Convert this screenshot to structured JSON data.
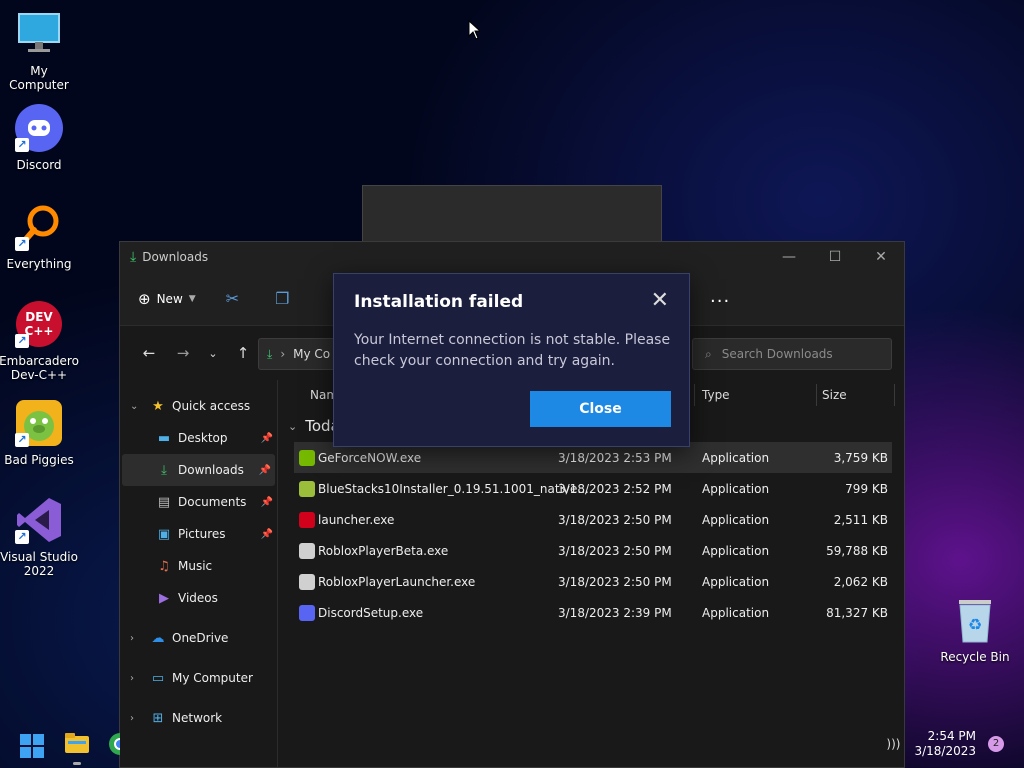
{
  "desktop": {
    "icons": [
      {
        "label": "My Computer"
      },
      {
        "label": "Discord"
      },
      {
        "label": "Everything"
      },
      {
        "label": "Embarcadero Dev-C++"
      },
      {
        "label": "Bad Piggies"
      },
      {
        "label": "Visual Studio 2022"
      },
      {
        "label": "Recycle Bin"
      }
    ]
  },
  "explorer": {
    "title": "Downloads",
    "toolbar": {
      "new_label": "New"
    },
    "address": {
      "path": "My Co"
    },
    "search": {
      "placeholder": "Search Downloads"
    },
    "nav": {
      "quick_access": "Quick access",
      "items": [
        {
          "label": "Desktop"
        },
        {
          "label": "Downloads"
        },
        {
          "label": "Documents"
        },
        {
          "label": "Pictures"
        },
        {
          "label": "Music"
        },
        {
          "label": "Videos"
        }
      ],
      "onedrive": "OneDrive",
      "my_computer": "My Computer",
      "network": "Network"
    },
    "columns": {
      "name": "Nam",
      "type": "Type",
      "size": "Size"
    },
    "group": "Toda",
    "files": [
      {
        "name": "GeForceNOW.exe",
        "date": "3/18/2023 2:53 PM",
        "type": "Application",
        "size": "3,759 KB",
        "icon_color": "#76b900"
      },
      {
        "name": "BlueStacks10Installer_0.19.51.1001_native...",
        "date": "3/18/2023 2:52 PM",
        "type": "Application",
        "size": "799 KB",
        "icon_color": "#9bbf3a"
      },
      {
        "name": "launcher.exe",
        "date": "3/18/2023 2:50 PM",
        "type": "Application",
        "size": "2,511 KB",
        "icon_color": "#d0021b"
      },
      {
        "name": "RobloxPlayerBeta.exe",
        "date": "3/18/2023 2:50 PM",
        "type": "Application",
        "size": "59,788 KB",
        "icon_color": "#d0d0d0"
      },
      {
        "name": "RobloxPlayerLauncher.exe",
        "date": "3/18/2023 2:50 PM",
        "type": "Application",
        "size": "2,062 KB",
        "icon_color": "#d0d0d0"
      },
      {
        "name": "DiscordSetup.exe",
        "date": "3/18/2023 2:39 PM",
        "type": "Application",
        "size": "81,327 KB",
        "icon_color": "#5865f2"
      }
    ]
  },
  "dialog": {
    "title": "Installation failed",
    "message": "Your Internet connection is not stable. Please check your connection and try again.",
    "close_label": "Close"
  },
  "taskbar": {
    "time": "2:54 PM",
    "date": "3/18/2023",
    "notifications": "2"
  }
}
